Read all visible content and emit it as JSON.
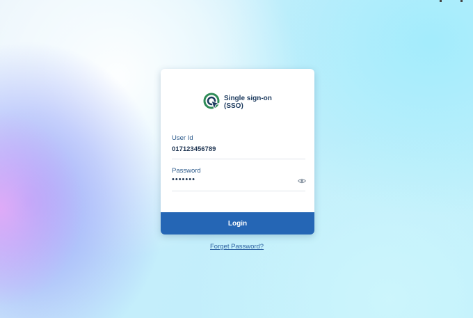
{
  "brand": {
    "title": "Single sign-on (SSO)",
    "logo_icon": "sso-target-cursor-icon"
  },
  "form": {
    "user_id_label": "User Id",
    "user_id_value": "017123456789",
    "password_label": "Password",
    "password_masked": "•••••••",
    "show_password_icon": "eye-icon"
  },
  "actions": {
    "login_label": "Login",
    "forgot_password_label": "Forget Password?"
  },
  "colors": {
    "primary": "#2566b5",
    "logo_green": "#2e8b57",
    "logo_navy": "#1c3a5e",
    "text_dark": "#1f3552",
    "label_blue": "#2d5b8c"
  }
}
